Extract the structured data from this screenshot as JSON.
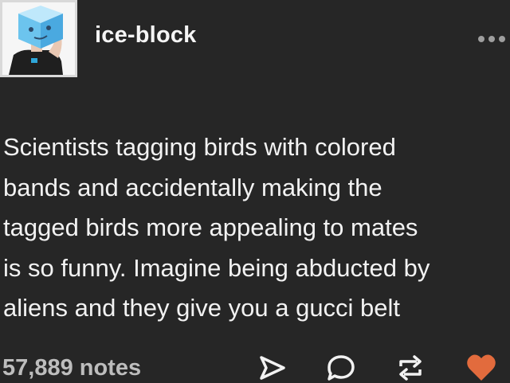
{
  "post": {
    "username": "ice-block",
    "avatar_icon": "ice-cube-head-avatar",
    "body_lines": [
      "Scientists tagging birds with colored",
      "bands and accidentally making the",
      "tagged birds more appealing to mates",
      "is so funny. Imagine being abducted by",
      "aliens and they give you a gucci belt"
    ],
    "notes_label": "57,889 notes"
  },
  "actions": {
    "more": "more-icon",
    "share": "share-icon",
    "reply": "reply-icon",
    "reblog": "reblog-icon",
    "like": "heart-icon"
  },
  "colors": {
    "background": "#262626",
    "text": "#f2f2f2",
    "muted": "#bdbdbd",
    "like": "#e26b3d"
  }
}
